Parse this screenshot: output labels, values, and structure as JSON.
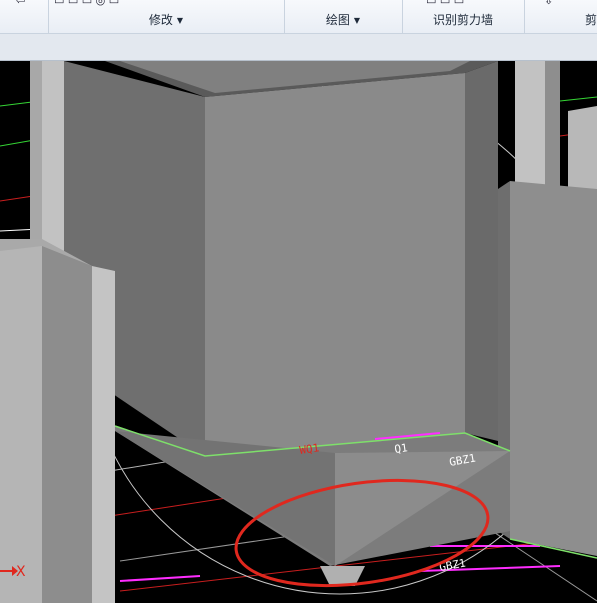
{
  "ribbon": {
    "groups": [
      {
        "label": "修改",
        "dropdown": true
      },
      {
        "label": "绘图",
        "dropdown": true
      },
      {
        "label": "识别剪力墙",
        "dropdown": false
      },
      {
        "label": "剪",
        "dropdown": false
      }
    ]
  },
  "viewport": {
    "axis_label": "X",
    "annotations": [
      "WQ1",
      "Q1",
      "GBZ1",
      "GBZ1"
    ]
  },
  "colors": {
    "background": "#000000",
    "wall_face": "#8a8a8a",
    "highlight_circle": "#e0281e",
    "edge_green": "#7ee06a",
    "magenta": "#ff2dff",
    "red_lines": "#c81e1e"
  }
}
